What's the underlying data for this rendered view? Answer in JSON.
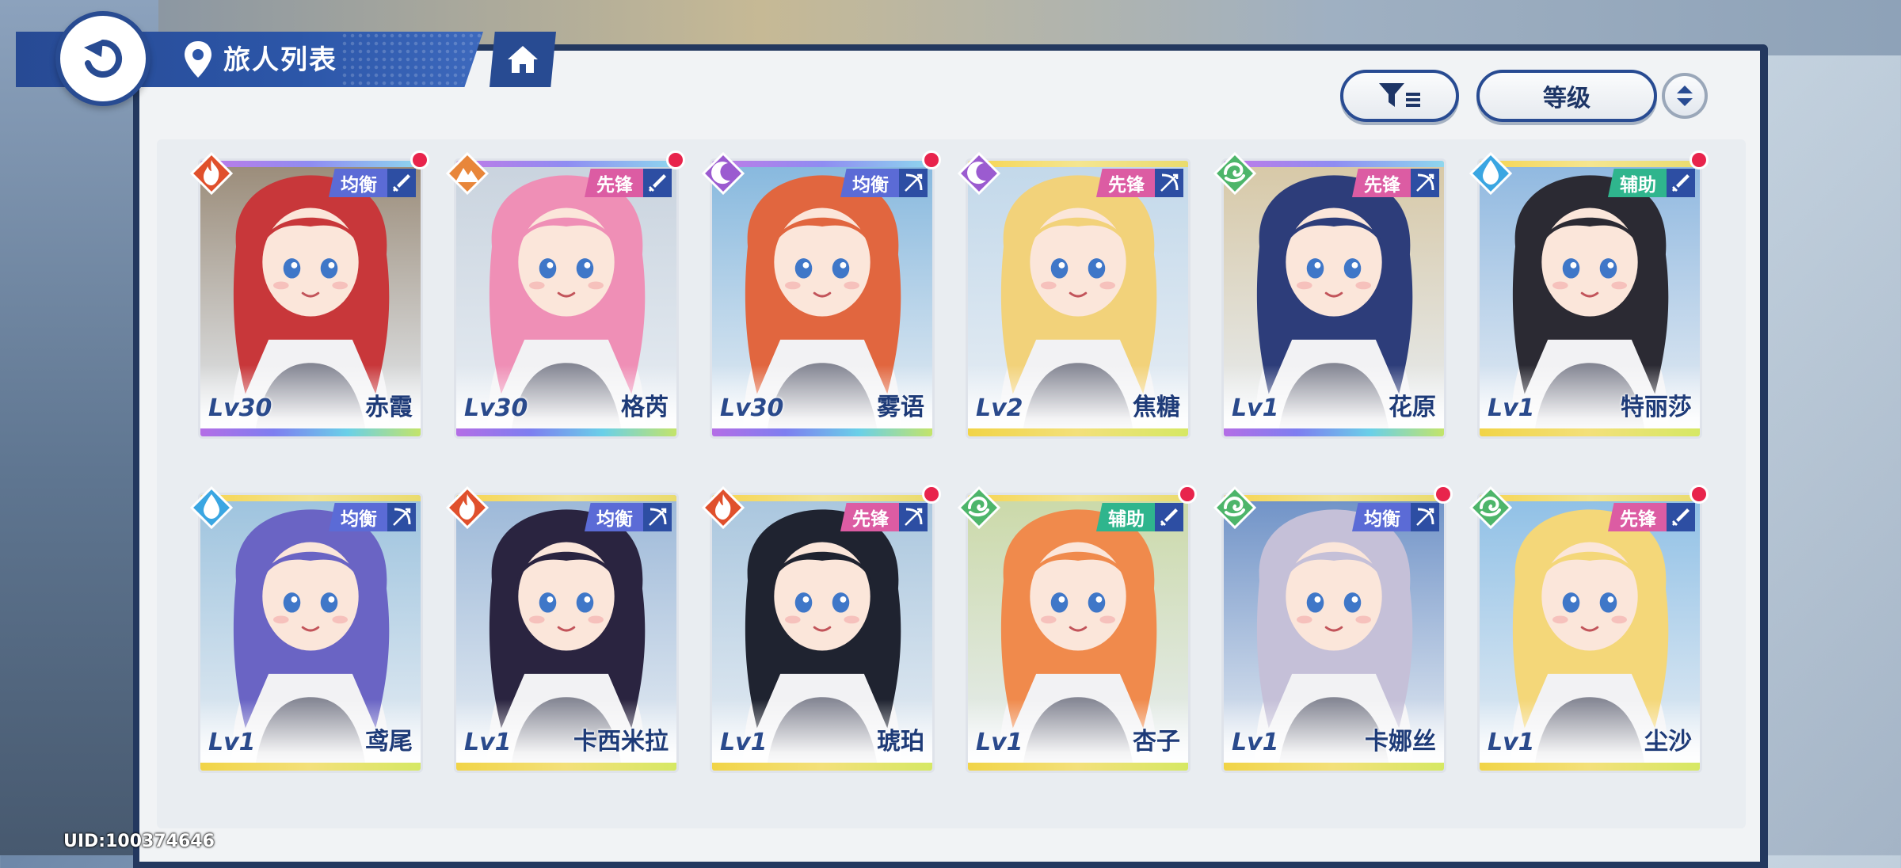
{
  "header": {
    "title": "旅人列表"
  },
  "controls": {
    "sort_label": "等级"
  },
  "footer": {
    "uid": "UID:100374646"
  },
  "colors": {
    "navy": "#284b92",
    "role_balance": "#5b6bd6",
    "role_vanguard": "#dc5ca3",
    "role_support": "#2fb58d",
    "fire": "#e0502c",
    "earth": "#e8863a",
    "dark": "#9b5bd0",
    "wind": "#4db56a",
    "water": "#3aa6e2",
    "new_dot": "#e8244c"
  },
  "characters": [
    {
      "name": "赤霞",
      "level": "Lv30",
      "role": "均衡",
      "element": "fire-icon",
      "weapon": "sword-icon",
      "new": true,
      "rarity": "purple",
      "hair": "#c8373a",
      "bg": "#9a8b78"
    },
    {
      "name": "格芮",
      "level": "Lv30",
      "role": "先锋",
      "element": "earth-icon",
      "weapon": "sword-icon",
      "new": true,
      "rarity": "purple",
      "hair": "#ef8fb6",
      "bg": "#c9d3de"
    },
    {
      "name": "雾语",
      "level": "Lv30",
      "role": "均衡",
      "element": "dark-icon",
      "weapon": "bow-icon",
      "new": true,
      "rarity": "purple",
      "hair": "#e1663f",
      "bg": "#86b8de"
    },
    {
      "name": "焦糖",
      "level": "Lv2",
      "role": "先锋",
      "element": "dark-icon",
      "weapon": "bow-icon",
      "new": false,
      "rarity": "gold",
      "hair": "#f2d27a",
      "bg": "#c2d8ea"
    },
    {
      "name": "花原",
      "level": "Lv1",
      "role": "先锋",
      "element": "wind-icon",
      "weapon": "bow-icon",
      "new": false,
      "rarity": "purple",
      "hair": "#2d3d7a",
      "bg": "#d7c8a6"
    },
    {
      "name": "特丽莎",
      "level": "Lv1",
      "role": "辅助",
      "element": "water-icon",
      "weapon": "sword-icon",
      "new": true,
      "rarity": "gold",
      "hair": "#2b2a33",
      "bg": "#8fb8e0"
    },
    {
      "name": "鸢尾",
      "level": "Lv1",
      "role": "均衡",
      "element": "water-icon",
      "weapon": "bow-icon",
      "new": false,
      "rarity": "gold",
      "hair": "#6a64c4",
      "bg": "#9dc3de"
    },
    {
      "name": "卡西米拉",
      "level": "Lv1",
      "role": "均衡",
      "element": "fire-icon",
      "weapon": "bow-icon",
      "new": false,
      "rarity": "gold",
      "hair": "#2a2440",
      "bg": "#9cb8d8"
    },
    {
      "name": "琥珀",
      "level": "Lv1",
      "role": "先锋",
      "element": "fire-icon",
      "weapon": "bow-icon",
      "new": true,
      "rarity": "gold",
      "hair": "#1f2330",
      "bg": "#a9c6de"
    },
    {
      "name": "杏子",
      "level": "Lv1",
      "role": "辅助",
      "element": "wind-icon",
      "weapon": "sword-icon",
      "new": true,
      "rarity": "gold",
      "hair": "#f08a4c",
      "bg": "#cbd9a8"
    },
    {
      "name": "卡娜丝",
      "level": "Lv1",
      "role": "均衡",
      "element": "wind-icon",
      "weapon": "bow-icon",
      "new": true,
      "rarity": "gold",
      "hair": "#c5c0d8",
      "bg": "#6f92c7"
    },
    {
      "name": "尘沙",
      "level": "Lv1",
      "role": "先锋",
      "element": "wind-icon",
      "weapon": "sword-icon",
      "new": true,
      "rarity": "gold",
      "hair": "#f4d779",
      "bg": "#8fc0e6"
    }
  ]
}
